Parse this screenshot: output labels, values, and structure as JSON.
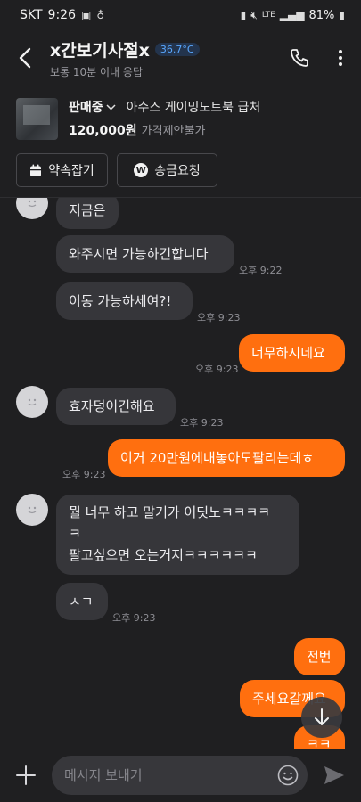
{
  "status_bar": {
    "carrier": "SKT",
    "time": "9:26",
    "network": "LTE",
    "battery": "81%"
  },
  "header": {
    "title": "x간보기사절x",
    "temperature": "36.7°C",
    "response_time": "보통 10분 이내 응답"
  },
  "product": {
    "status": "판매중",
    "name": "아수스 게이밍노트북 급처",
    "price": "120,000원",
    "price_note": "가격제안불가"
  },
  "actions": {
    "appointment": "약속잡기",
    "send_money": "송금요청"
  },
  "messages": [
    {
      "text": "지금은",
      "time": ""
    },
    {
      "text": "와주시면 가능하긴합니다",
      "time": "오후 9:22"
    },
    {
      "text": "이동 가능하세여?!",
      "time": "오후 9:23"
    },
    {
      "text": "너무하시네요",
      "time": "오후 9:23"
    },
    {
      "text": "효자덩이긴해요",
      "time": "오후 9:23"
    },
    {
      "text": "이거 20만원에내놓아도팔리는데ㅎ",
      "time": "오후 9:23"
    },
    {
      "text_line1": "뭘 너무 하고 말거가 어딧노ㅋㅋㅋㅋ",
      "text_line2": "ㅋ",
      "text_line3": "팔고싶으면 오는거지ㅋㅋㅋㅋㅋㅋ"
    },
    {
      "text": "ㅅㄱ",
      "time": "오후 9:23"
    },
    {
      "text": "전번",
      "time": ""
    },
    {
      "text": "주세요갈께요",
      "time": ""
    },
    {
      "text": "ㅋㅋ",
      "time": ""
    }
  ],
  "composer": {
    "placeholder": "메시지 보내기"
  },
  "colors": {
    "accent": "#ff6f0f",
    "background": "#1f1f21",
    "incoming_bubble": "#36363a",
    "temperature": "#5aa8ff"
  },
  "icons": {
    "back": "chevron-left-icon",
    "call": "phone-icon",
    "more": "more-vertical-icon",
    "calendar": "calendar-icon",
    "won": "won-icon",
    "scroll_down": "arrow-down-icon",
    "plus": "plus-icon",
    "emoji": "smile-icon",
    "send": "send-icon"
  }
}
